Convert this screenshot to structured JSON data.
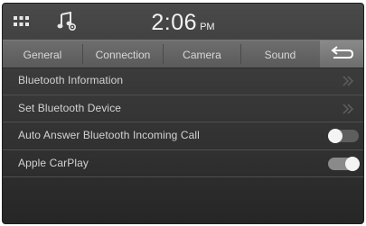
{
  "status": {
    "time": "2:06",
    "ampm": "PM",
    "icons": [
      "grid-menu-icon",
      "music-source-icon"
    ]
  },
  "tabs": [
    {
      "label": "General"
    },
    {
      "label": "Connection"
    },
    {
      "label": "Camera"
    },
    {
      "label": "Sound"
    }
  ],
  "back_icon": "back-arrow-icon",
  "rows": [
    {
      "label": "Bluetooth Information",
      "control": "chevron"
    },
    {
      "label": "Set Bluetooth Device",
      "control": "chevron"
    },
    {
      "label": "Auto Answer Bluetooth Incoming Call",
      "control": "toggle",
      "state": "off"
    },
    {
      "label": "Apple CarPlay",
      "control": "toggle",
      "state": "on"
    }
  ],
  "colors": {
    "background": "#333333",
    "tab_bar": "#626262",
    "text": "#d3d3d3",
    "toggle_knob": "#f4f4f4"
  }
}
